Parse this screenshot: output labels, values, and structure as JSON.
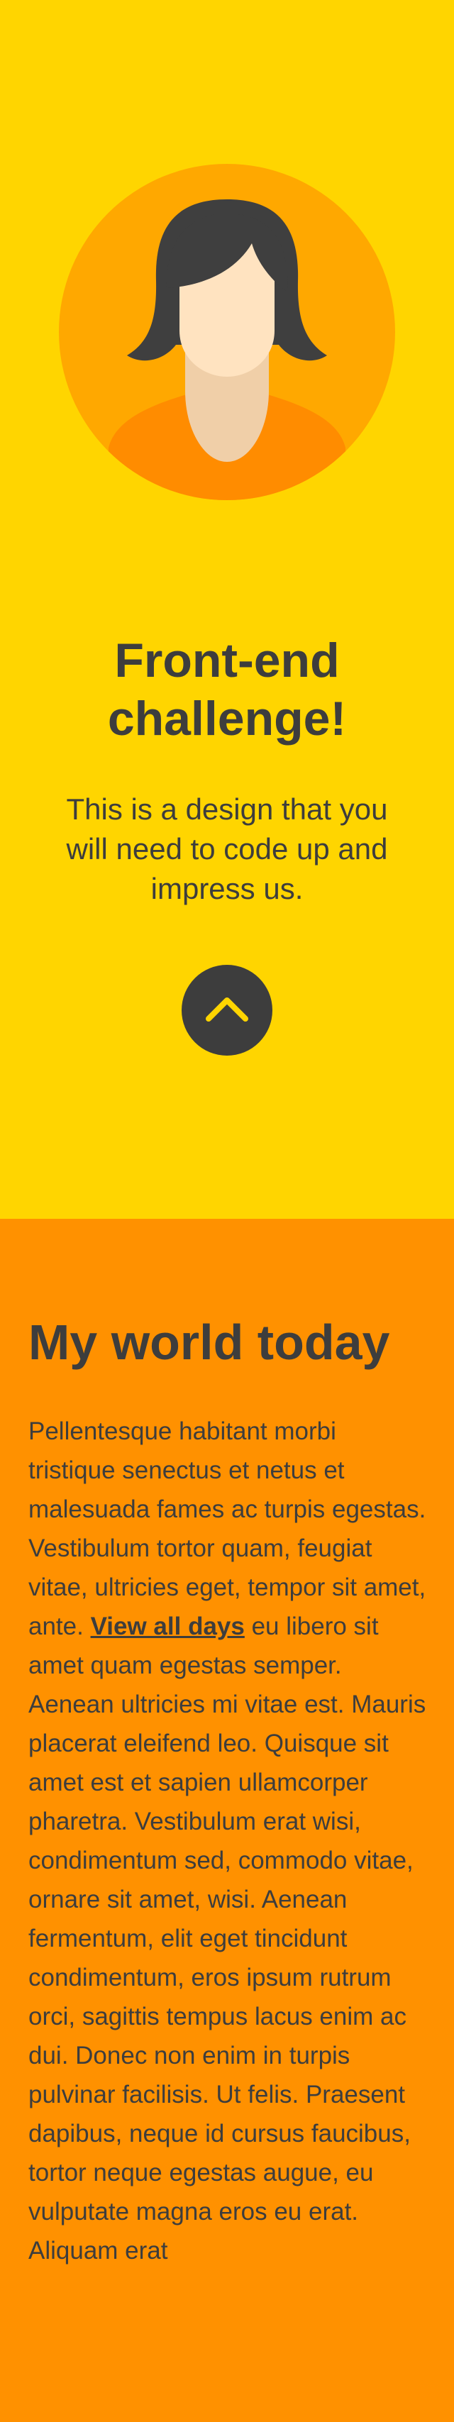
{
  "hero": {
    "avatar_label": "woman-avatar",
    "title": "Front-end challenge!",
    "subtitle": "This is a design that you will need to code up and impress us.",
    "scroll_up_icon": "chevron-up-icon"
  },
  "content": {
    "title": "My world today",
    "paragraph_before_link": "Pellentesque habitant morbi tristique senectus et netus et malesuada fames ac turpis egestas. Vestibulum tortor quam, feugiat vitae, ultricies eget, tempor sit amet, ante. ",
    "link_text": "View all days",
    "paragraph_after_link": " eu libero sit amet quam egestas semper. Aenean ultricies mi vitae est. Mauris placerat eleifend leo. Quisque sit amet est et sapien ullamcorper pharetra. Vestibulum erat wisi, condimentum sed, commodo vitae, ornare sit amet, wisi. Aenean fermentum, elit eget tincidunt condimentum, eros ipsum rutrum orci, sagittis tempus lacus enim ac dui. Donec non enim in turpis pulvinar facilisis. Ut felis. Praesent dapibus, neque id cursus faucibus, tortor neque egestas augue, eu vulputate magna eros eu erat. Aliquam erat"
  },
  "colors": {
    "hero_background": "#ffd500",
    "content_background": "#ff9100",
    "text": "#3d3d3d",
    "avatar_circle": "#ffa800",
    "avatar_shirt": "#ff8c00",
    "avatar_hair": "#3f3f3f",
    "avatar_skin": "#ffe3c0",
    "avatar_neck": "#f0cfa8",
    "chevron": "#ffd500"
  }
}
